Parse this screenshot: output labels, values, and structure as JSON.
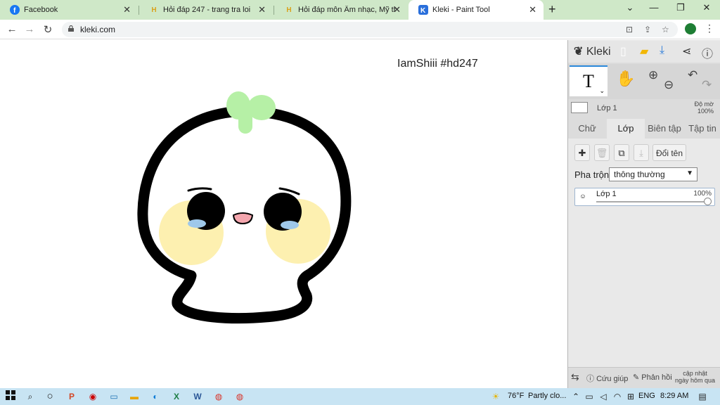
{
  "browser": {
    "tabs": [
      {
        "label": "Facebook",
        "icon": "facebook-icon"
      },
      {
        "label": "Hỏi đáp 247 - trang tra loi",
        "icon": "hd247-icon"
      },
      {
        "label": "Hỏi đáp môn Âm nhạc, Mỹ thuật",
        "icon": "hd247-icon"
      },
      {
        "label": "Kleki - Paint Tool",
        "icon": "kleki-icon",
        "active": true
      }
    ],
    "url": "kleki.com"
  },
  "canvas": {
    "signature": "IamShiii #hd247",
    "colors": {
      "outline": "#000000",
      "sprout": "#b6f0a6",
      "cheeks": "#fdf0b0",
      "mouth": "#f4a6ae",
      "tears": "#9ec8ea"
    }
  },
  "panel": {
    "logo": "Kleki",
    "active_tool": "T",
    "current_layer": {
      "name": "Lớp 1",
      "opacity_label": "Độ mờ",
      "opacity": "100%"
    },
    "tabs": [
      "Chữ",
      "Lớp",
      "Biên tập",
      "Tập tin"
    ],
    "active_tab": "Lớp",
    "rename_label": "Đổi tên",
    "blend_label": "Pha trộn",
    "blend_value": "thông thường",
    "layers": [
      {
        "name": "Lớp 1",
        "opacity": "100%"
      }
    ],
    "footer": {
      "help": "Cứu giúp",
      "feedback": "Phản hồi",
      "update_line1": "cập nhật",
      "update_line2": "ngày hôm qua"
    }
  },
  "taskbar": {
    "weather_temp": "76°F",
    "weather_text": "Partly clo...",
    "language": "ENG",
    "time": "8:29 AM"
  }
}
